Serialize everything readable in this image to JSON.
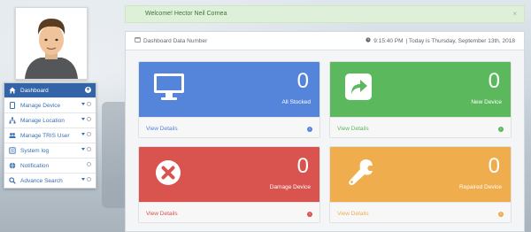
{
  "alert": {
    "message": "Welcome! Hector Neil Cornea",
    "close": "×"
  },
  "panel": {
    "title": "Dashboard Data Number",
    "time": "9:15:40 PM",
    "date_text": "| Today is Thursday, September 13th, 2018"
  },
  "sidebar": {
    "items": [
      {
        "label": "Dashboard",
        "icon": "home-icon"
      },
      {
        "label": "Manage Device",
        "icon": "tablet-icon"
      },
      {
        "label": "Manage Location",
        "icon": "sitemap-icon"
      },
      {
        "label": "Manage TRIS User",
        "icon": "users-icon"
      },
      {
        "label": "System log",
        "icon": "list-icon"
      },
      {
        "label": "Notification",
        "icon": "globe-icon"
      },
      {
        "label": "Advance Search",
        "icon": "search-icon"
      }
    ]
  },
  "cards": [
    {
      "count": "0",
      "label": "All Stocked",
      "footer": "View Details",
      "color": "#5585db",
      "icon": "monitor-icon"
    },
    {
      "count": "0",
      "label": "New Device",
      "footer": "View Details",
      "color": "#5cb85c",
      "icon": "share-arrow-icon"
    },
    {
      "count": "0",
      "label": "Damage Device",
      "footer": "View Details",
      "color": "#d9534f",
      "icon": "times-circle-icon"
    },
    {
      "count": "0",
      "label": "Repaired Device",
      "footer": "View Details",
      "color": "#f0ad4e",
      "icon": "wrench-icon"
    }
  ]
}
